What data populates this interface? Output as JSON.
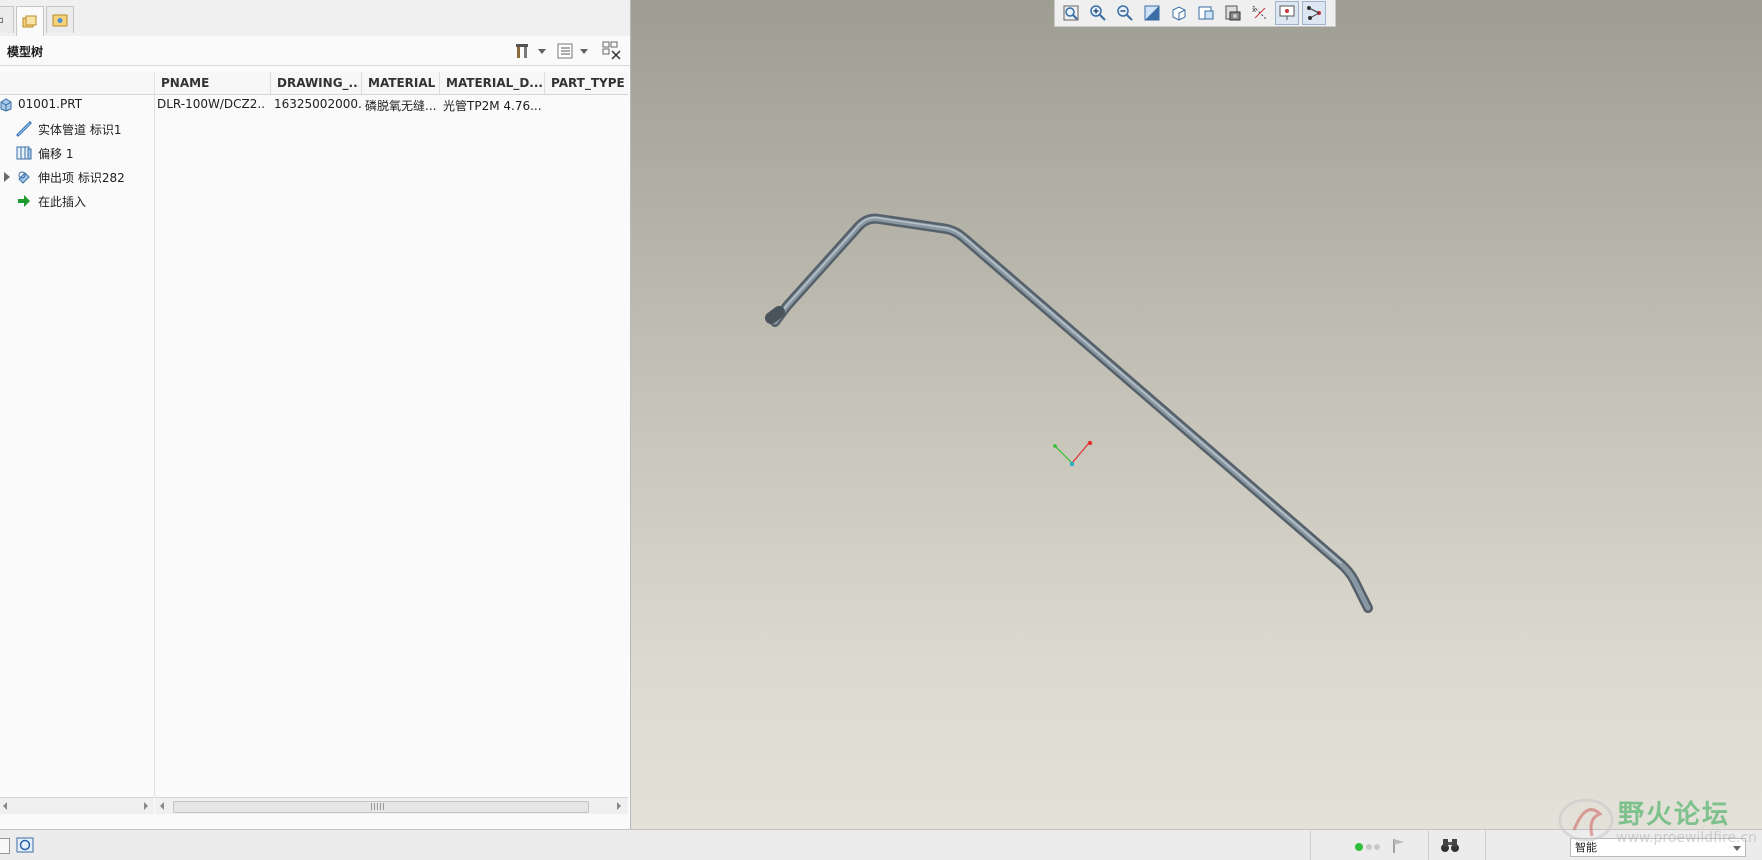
{
  "model_tree": {
    "title": "模型树",
    "columns": [
      "PNAME",
      "DRAWING_...",
      "MATERIAL",
      "MATERIAL_D...",
      "PART_TYPE"
    ],
    "rows": [
      {
        "name": "01001.PRT",
        "icon": "part-icon",
        "pname": "DLR-100W/DCZ2...",
        "drawing": "16325002000...",
        "material": "磷脱氧无缝...",
        "material_d": "光管TP2M 4.76..."
      },
      {
        "name": "实体管道 标识1",
        "icon": "pipe-feature-icon"
      },
      {
        "name": "偏移 1",
        "icon": "offset-icon"
      },
      {
        "name": "伸出项 标识282",
        "icon": "protrusion-icon",
        "expandable": true
      },
      {
        "name": "在此插入",
        "icon": "insert-here-arrow-icon"
      }
    ]
  },
  "view_toolbar": {
    "buttons": [
      "refit-icon",
      "zoom-in-icon",
      "zoom-out-icon",
      "repaint-icon",
      "display-style-icon",
      "saved-views-icon",
      "view-manager-icon",
      "datum-display-icon",
      "spin-center-icon",
      "annotation-display-icon"
    ]
  },
  "status_bar": {
    "filter_value": "智能"
  },
  "watermark": {
    "text": "野火论坛",
    "url": "www.proewildfire.cn"
  },
  "colors": {
    "viewport_top": "#9e9d92",
    "viewport_bottom": "#e3e1d8",
    "pipe": "#6f7b84",
    "csys_x": "#e03030",
    "csys_y": "#30c030",
    "csys_z": "#20b0c0"
  }
}
